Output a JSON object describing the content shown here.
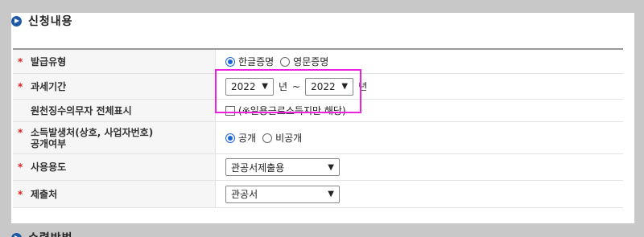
{
  "section": {
    "title": "신청내용"
  },
  "rows": [
    {
      "label": "발급유형",
      "required": true
    },
    {
      "label": "과세기간",
      "required": true
    },
    {
      "label": "원천징수의무자 전체표시",
      "required": false
    },
    {
      "label": "소득발생처(상호, 사업자번호)",
      "label2": "공개여부",
      "required": true
    },
    {
      "label": "사용용도",
      "required": true
    },
    {
      "label": "제출처",
      "required": true
    }
  ],
  "issue_type": {
    "options": [
      "한글증명",
      "영문증명"
    ],
    "selected": "한글증명"
  },
  "tax_period": {
    "from_year": "2022",
    "to_year": "2022",
    "unit": "년",
    "separator": "~"
  },
  "withholding": {
    "checked": false,
    "note": "(※일용근로소득지만 해당)"
  },
  "disclosure": {
    "options": [
      "공개",
      "비공개"
    ],
    "selected": "공개"
  },
  "purpose": {
    "value": "관공서제출용"
  },
  "submit_to": {
    "value": "관공서"
  },
  "required_mark": "*",
  "next_section": {
    "title": "수령방법"
  },
  "colors": {
    "highlight": "#ee22dd",
    "accent": "#1f5aa6",
    "required": "#dd2222"
  }
}
